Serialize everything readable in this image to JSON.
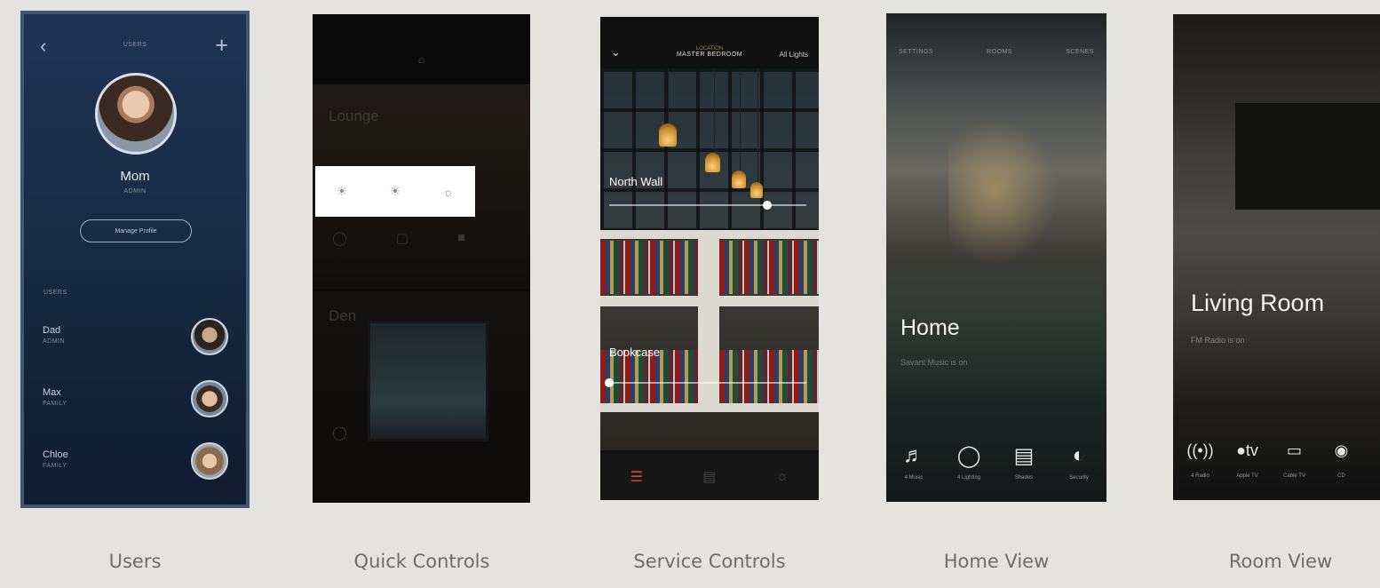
{
  "captions": [
    "Users",
    "Quick Controls",
    "Service Controls",
    "Home View",
    "Room View"
  ],
  "users": {
    "back_icon": "chevron-left-icon",
    "add_icon": "plus-icon",
    "header_title": "USERS",
    "profile_name": "Mom",
    "profile_role": "Admin",
    "manage_button": "Manage Profile",
    "section_label": "Users",
    "list": [
      {
        "name": "Dad",
        "role": "Admin"
      },
      {
        "name": "Max",
        "role": "Family"
      },
      {
        "name": "Chloe",
        "role": "Family"
      }
    ]
  },
  "quick": {
    "room1": "Lounge",
    "room2": "Den"
  },
  "service": {
    "location_label": "LOCATION",
    "room": "MASTER BEDROOM",
    "all_label": "All Lights",
    "sliders": [
      {
        "label": "North Wall",
        "value": 0.8
      },
      {
        "label": "Bookcase",
        "value": 0.0
      }
    ]
  },
  "home": {
    "nav": [
      "SETTINGS",
      "ROOMS",
      "SCENES"
    ],
    "title": "Home",
    "subtitle": "Savant Music is on",
    "services": [
      {
        "icon": "music-icon",
        "label": "4 Music"
      },
      {
        "icon": "lightbulb-icon",
        "label": "4 Lighting"
      },
      {
        "icon": "shades-icon",
        "label": "Shades"
      },
      {
        "icon": "shield-icon",
        "label": "Security"
      }
    ]
  },
  "room": {
    "title": "Living Room",
    "subtitle": "FM Radio is on",
    "services": [
      {
        "icon": "radio-icon",
        "label": "4 Radio"
      },
      {
        "icon": "apple-tv-icon",
        "label": "Apple TV"
      },
      {
        "icon": "tv-icon",
        "label": "Cable TV"
      },
      {
        "icon": "cd-icon",
        "label": "CD"
      }
    ]
  }
}
